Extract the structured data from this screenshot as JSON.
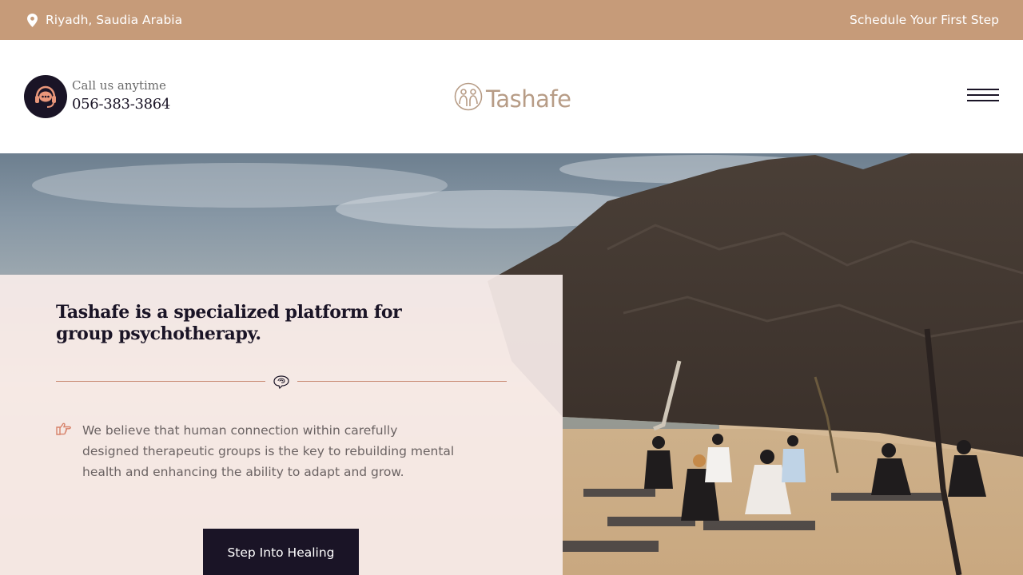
{
  "topbar": {
    "location": "Riyadh, Saudia Arabia",
    "location_icon": "map-pin-icon",
    "schedule_link": "Schedule Your First Step"
  },
  "header": {
    "call_label": "Call us anytime",
    "phone": "056-383-3864",
    "call_icon": "headset-chat-icon",
    "logo_text": "Tashafe",
    "menu_icon": "hamburger-menu-icon"
  },
  "hero": {
    "title": "Tashafe is a specialized platform for group psychotherapy.",
    "divider_icon": "brain-outline-icon",
    "bullet_icon": "pointing-hand-icon",
    "bullet_text": "We believe that human connection within carefully designed therapeutic groups is the key to rebuilding mental health and enhancing the ability to adapt and grow.",
    "cta_label": "Step Into Healing"
  },
  "colors": {
    "topbar_bg": "#c69b79",
    "dark": "#1a1426",
    "accent": "#c98b74",
    "logo": "#b79c86"
  }
}
